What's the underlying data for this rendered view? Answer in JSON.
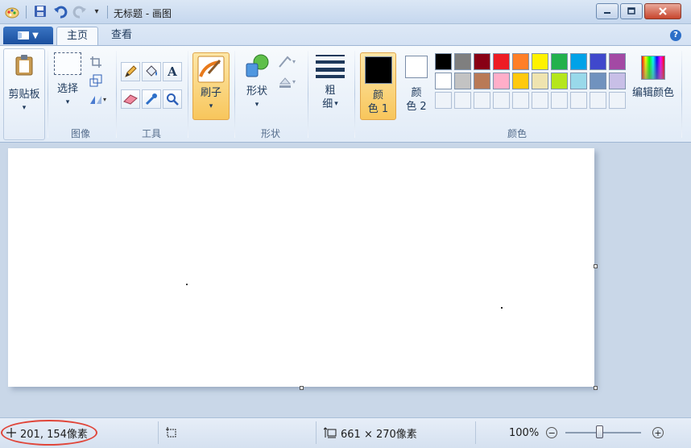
{
  "window": {
    "title": "无标题 - 画图"
  },
  "quick_access": {
    "dropdown": "▾"
  },
  "tabs": {
    "home": "主页",
    "view": "查看",
    "help": "?"
  },
  "ribbon": {
    "clipboard": {
      "label": "剪贴板"
    },
    "image": {
      "group_label": "图像",
      "select_label": "选择"
    },
    "tools": {
      "group_label": "工具",
      "text_tool": "A"
    },
    "brushes": {
      "label": "刷子"
    },
    "shapes": {
      "label": "形状",
      "group_label": "形状"
    },
    "size": {
      "label_line1": "粗",
      "label_line2": "细"
    },
    "colors": {
      "group_label": "颜色",
      "color1_line1": "颜",
      "color1_line2": "色 1",
      "color2_line1": "颜",
      "color2_line2": "色 2",
      "color1_value": "#000000",
      "color2_value": "#ffffff",
      "edit_label": "编辑颜色",
      "palette": [
        "#000000",
        "#7f7f7f",
        "#880015",
        "#ed1c24",
        "#ff7f27",
        "#fff200",
        "#22b14c",
        "#00a2e8",
        "#3f48cc",
        "#a349a4",
        "#ffffff",
        "#c3c3c3",
        "#b97a57",
        "#ffaec9",
        "#ffc90e",
        "#efe4b0",
        "#b5e61d",
        "#99d9ea",
        "#7092be",
        "#c8bfe7"
      ]
    }
  },
  "statusbar": {
    "cursor_position": "201, 154像素",
    "canvas_size": "661 × 270像素",
    "zoom_level": "100%",
    "zoom_out": "−",
    "zoom_in": "+"
  },
  "zoom_slider": {
    "position_fraction": 0.45
  }
}
